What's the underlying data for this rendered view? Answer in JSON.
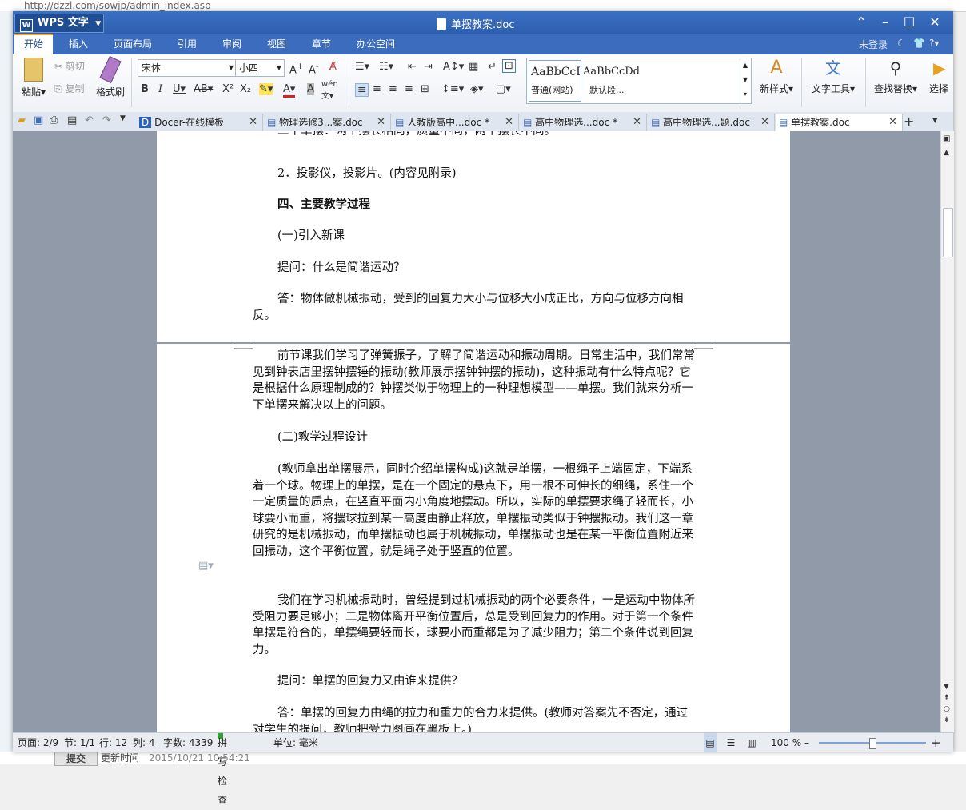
{
  "browser": {
    "url": "http://dzzl.com/sowjp/admin_index.asp",
    "bottom_submit": "提交",
    "bottom_label": "更新时间",
    "bottom_time": "2015/10/21 10:54:21"
  },
  "window": {
    "app_button": "WPS 文字",
    "doc_title": "单摆教案.doc"
  },
  "menu": {
    "items": [
      "开始",
      "插入",
      "页面布局",
      "引用",
      "审阅",
      "视图",
      "章节",
      "办公空间"
    ],
    "login": "未登录"
  },
  "ribbon": {
    "paste": "粘贴",
    "cut": "剪切",
    "copy": "复制",
    "format_painter": "格式刷",
    "font_name": "宋体",
    "font_size": "小四",
    "style1_preview": "AaBbCcI",
    "style1_label": "普通(网站)",
    "style2_preview": "AaBbCcDd",
    "style2_label": "默认段...",
    "new_style": "新样式",
    "text_tools": "文字工具",
    "find_replace": "查找替换",
    "select": "选择"
  },
  "tabs": [
    {
      "label": "Docer-在线模板"
    },
    {
      "label": "物理选修3...案.doc"
    },
    {
      "label": "人教版高中...doc *"
    },
    {
      "label": "高中物理选...doc *"
    },
    {
      "label": "高中物理选...题.doc"
    },
    {
      "label": "单摆教案.doc"
    }
  ],
  "document": {
    "top_cut": "二个单摆：两个摆长相同，质量不同，两个摆长不同。",
    "p1": "2．投影仪，投影片。(内容见附录)",
    "h1": "四、主要教学过程",
    "p2": "(一)引入新课",
    "p3": "提问：什么是简谐运动？",
    "p4": "答：物体做机械振动，受到的回复力大小与位移大小成正比，方向与位移方向相反。",
    "p5": "前节课我们学习了弹簧振子，了解了简谐运动和振动周期。日常生活中，我们常常见到钟表店里摆钟摆锤的振动(教师展示摆钟钟摆的振动)，这种振动有什么特点呢？它是根据什么原理制成的？钟摆类似于物理上的一种理想模型——单摆。我们就来分析一下单摆来解决以上的问题。",
    "p6": "(二)教学过程设计",
    "p7": "(教师拿出单摆展示，同时介绍单摆构成)这就是单摆，一根绳子上端固定，下端系着一个球。物理上的单摆，是在一个固定的悬点下，用一根不可伸长的细绳，系住一个一定质量的质点，在竖直平面内小角度地摆动。所以，实际的单摆要求绳子轻而长，小球要小而重，将摆球拉到某一高度由静止释放，单摆振动类似于钟摆振动。我们这一章研究的是机械振动，而单摆振动也属于机械振动，单摆振动也是在某一平衡位置附近来回振动，这个平衡位置，就是绳子处于竖直的位置。",
    "p8": "我们在学习机械振动时，曾经提到过机械振动的两个必要条件，一是运动中物体所受阻力要足够小；二是物体离开平衡位置后，总是受到回复力的作用。对于第一个条件单摆是符合的，单摆绳要轻而长，球要小而重都是为了减少阻力；第二个条件说到回复力。",
    "p9": "提问：单摆的回复力又由谁来提供？",
    "p10": "答：单摆的回复力由绳的拉力和重力的合力来提供。(教师对答案先不否定，通过对学生的提问，教师把受力图画在黑板上。)"
  },
  "status": {
    "page": "页面: 2/9",
    "section": "节: 1/1",
    "row": "行: 12",
    "col": "列: 4",
    "words": "字数: 4339",
    "spell": "拼写检查",
    "unit": "单位: 毫米",
    "zoom": "100 %"
  },
  "colors": {
    "title_bar": "#2e5fae",
    "accent": "#f3a32f"
  }
}
